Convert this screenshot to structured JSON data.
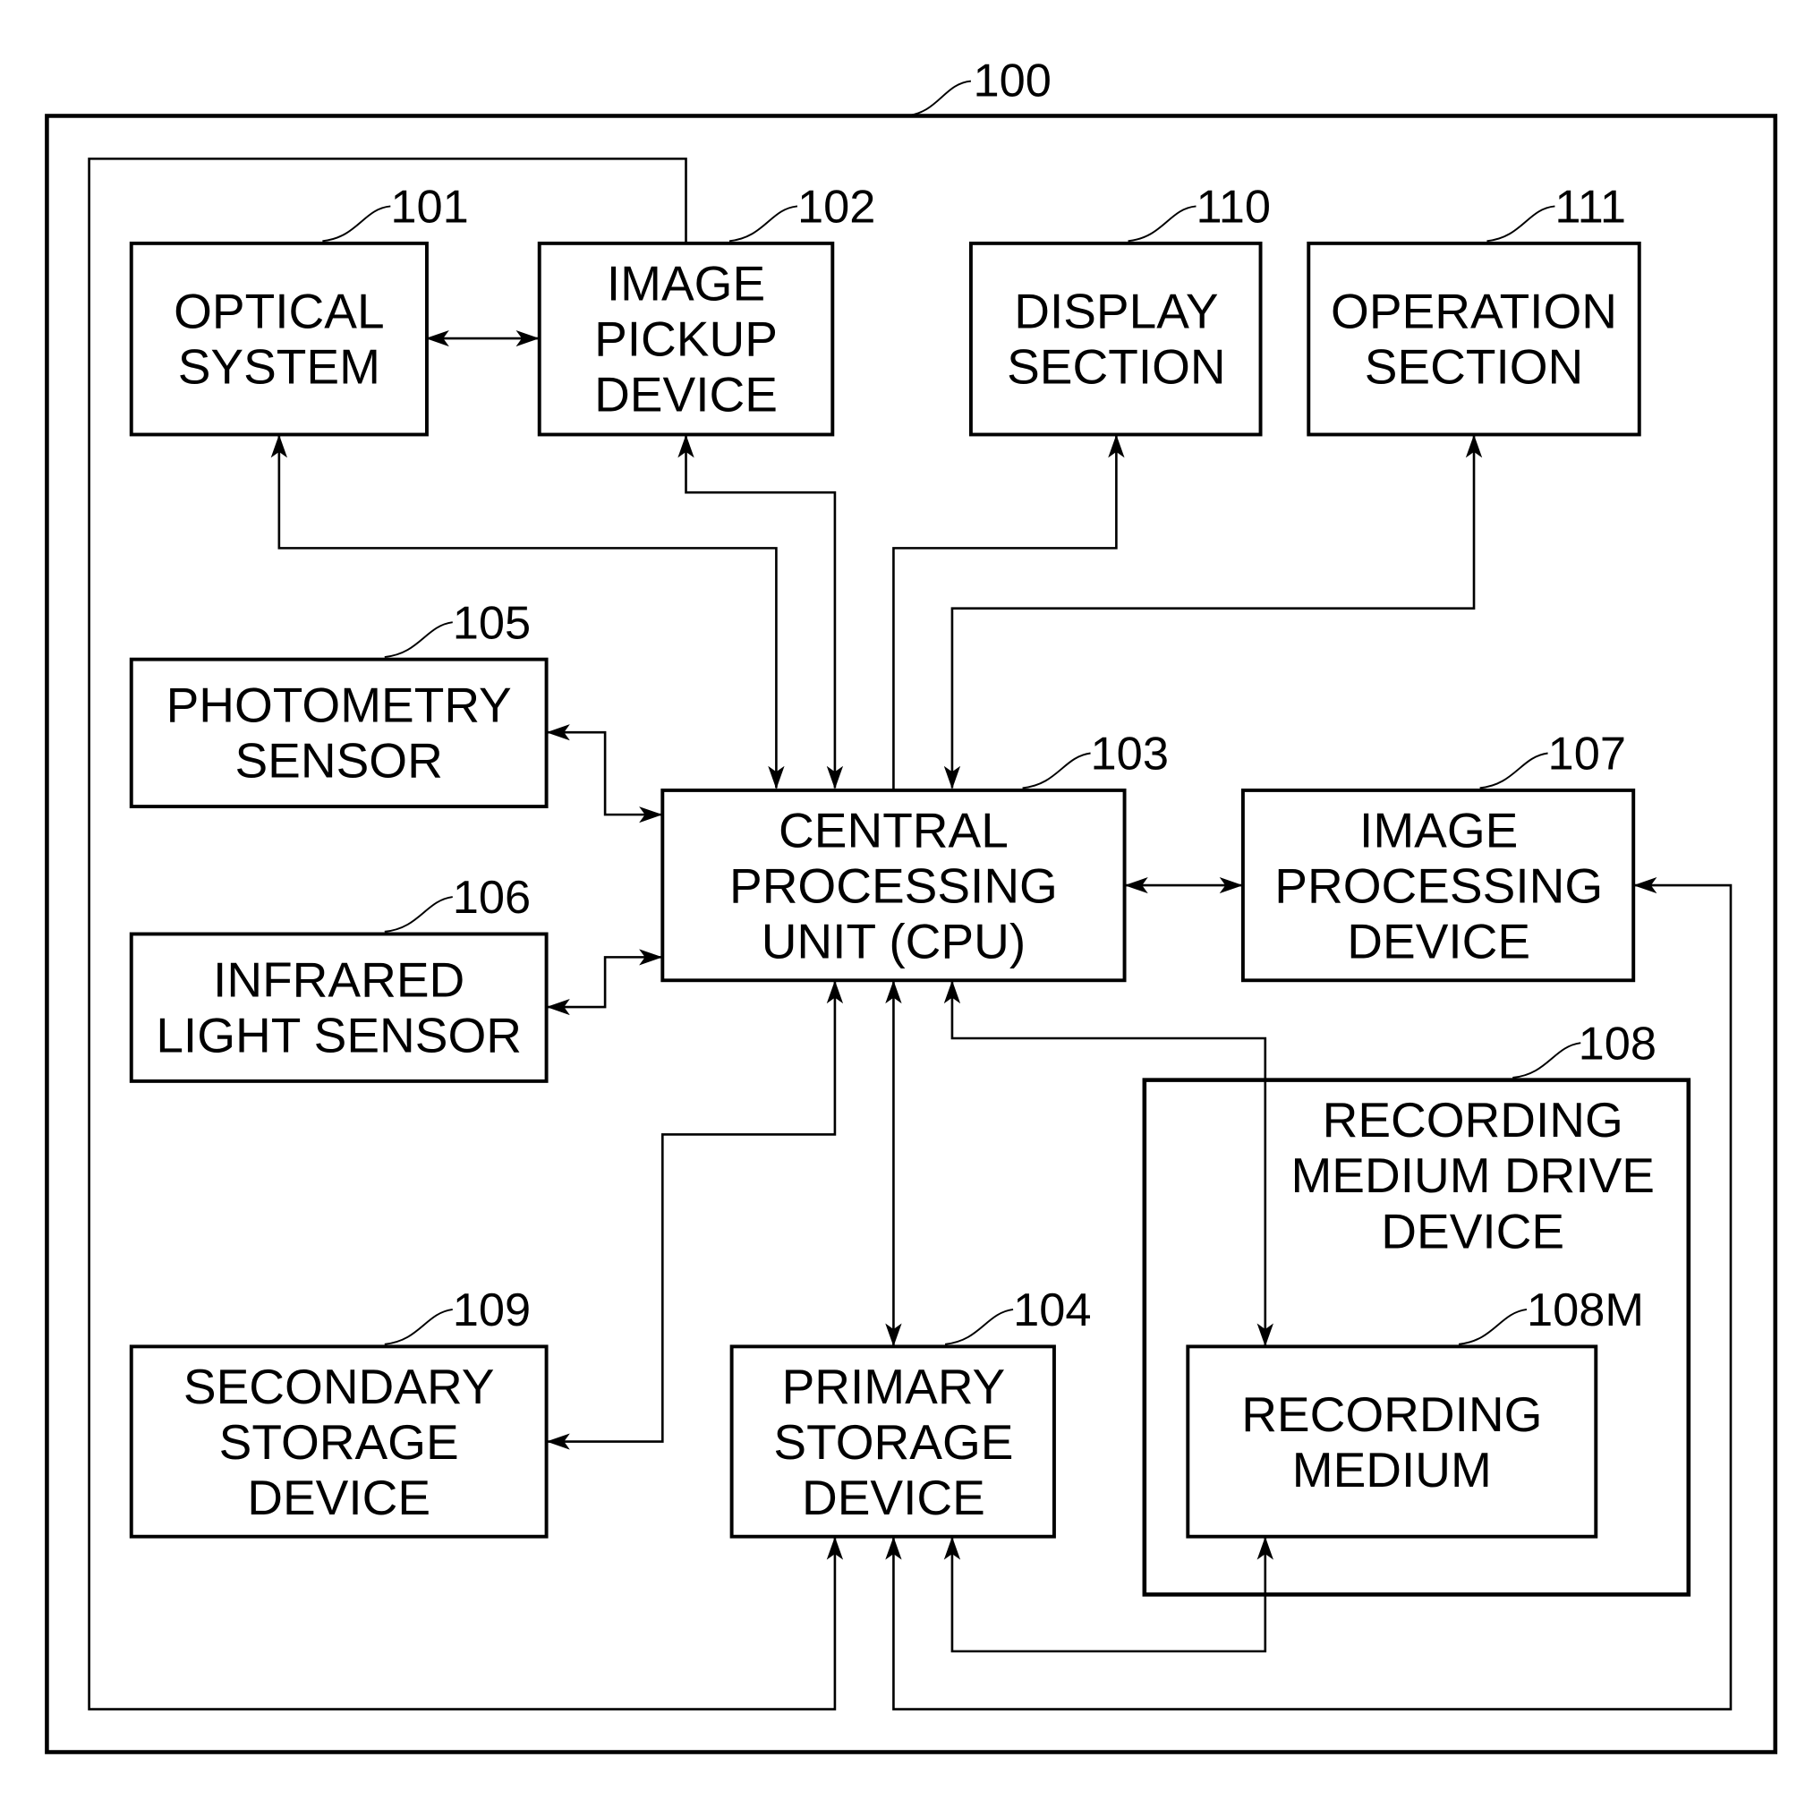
{
  "figure": {
    "ref": "100",
    "blocks": [
      {
        "id": "optical",
        "ref": "101",
        "lines": [
          "OPTICAL",
          "SYSTEM"
        ]
      },
      {
        "id": "pickup",
        "ref": "102",
        "lines": [
          "IMAGE",
          "PICKUP",
          "DEVICE"
        ]
      },
      {
        "id": "display",
        "ref": "110",
        "lines": [
          "DISPLAY",
          "SECTION"
        ]
      },
      {
        "id": "operation",
        "ref": "111",
        "lines": [
          "OPERATION",
          "SECTION"
        ]
      },
      {
        "id": "photometry",
        "ref": "105",
        "lines": [
          "PHOTOMETRY",
          "SENSOR"
        ]
      },
      {
        "id": "infrared",
        "ref": "106",
        "lines": [
          "INFRARED",
          "LIGHT SENSOR"
        ]
      },
      {
        "id": "cpu",
        "ref": "103",
        "lines": [
          "CENTRAL",
          "PROCESSING",
          "UNIT (CPU)"
        ]
      },
      {
        "id": "imgproc",
        "ref": "107",
        "lines": [
          "IMAGE",
          "PROCESSING",
          "DEVICE"
        ]
      },
      {
        "id": "drive",
        "ref": "108",
        "lines": [
          "RECORDING",
          "MEDIUM DRIVE",
          "DEVICE"
        ]
      },
      {
        "id": "medium",
        "ref": "108M",
        "lines": [
          "RECORDING",
          "MEDIUM"
        ]
      },
      {
        "id": "secondary",
        "ref": "109",
        "lines": [
          "SECONDARY",
          "STORAGE",
          "DEVICE"
        ]
      },
      {
        "id": "primary",
        "ref": "104",
        "lines": [
          "PRIMARY",
          "STORAGE",
          "DEVICE"
        ]
      }
    ],
    "connections": [
      {
        "from": "optical",
        "to": "pickup",
        "type": "bidirectional"
      },
      {
        "from": "cpu",
        "to": "optical",
        "type": "bidirectional"
      },
      {
        "from": "cpu",
        "to": "pickup",
        "type": "bidirectional"
      },
      {
        "from": "cpu",
        "to": "display",
        "type": "directed"
      },
      {
        "from": "operation",
        "to": "cpu",
        "type": "directed"
      },
      {
        "from": "cpu",
        "to": "photometry",
        "type": "bidirectional"
      },
      {
        "from": "cpu",
        "to": "infrared",
        "type": "bidirectional"
      },
      {
        "from": "cpu",
        "to": "imgproc",
        "type": "bidirectional"
      },
      {
        "from": "cpu",
        "to": "secondary",
        "type": "bidirectional"
      },
      {
        "from": "cpu",
        "to": "primary",
        "type": "bidirectional"
      },
      {
        "from": "cpu",
        "to": "medium",
        "type": "bidirectional"
      },
      {
        "from": "medium",
        "to": "primary",
        "type": "directed"
      },
      {
        "from": "pickup",
        "to": "primary",
        "type": "directed"
      },
      {
        "from": "primary",
        "to": "imgproc",
        "type": "directed"
      }
    ]
  }
}
